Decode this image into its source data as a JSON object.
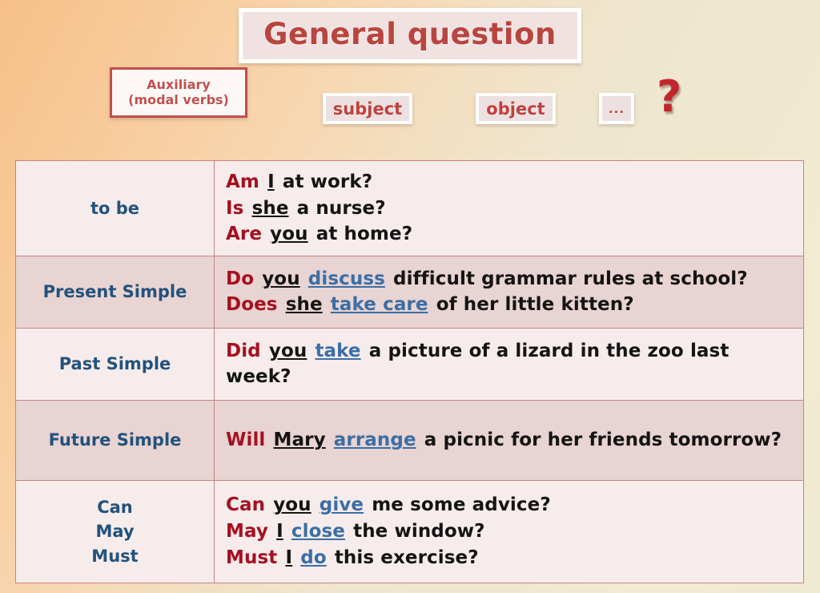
{
  "title": "General question",
  "structure_slots": {
    "auxiliary": "Auxiliary\n(modal verbs)",
    "auxiliary_line1": "Auxiliary",
    "auxiliary_line2": "(modal verbs)",
    "subject": "subject",
    "object": "object",
    "ellipsis": "...",
    "question_mark": "?"
  },
  "table": {
    "rows": [
      {
        "label_lines": [
          "to be"
        ],
        "examples": [
          {
            "aux": "Am",
            "subject": "I",
            "verb": "",
            "rest": "at work?"
          },
          {
            "aux": "Is",
            "subject": "she",
            "verb": "",
            "rest": "a nurse?"
          },
          {
            "aux": "Are",
            "subject": "you",
            "verb": "",
            "rest": "at home?"
          }
        ]
      },
      {
        "label_lines": [
          "Present Simple"
        ],
        "examples": [
          {
            "aux": "Do",
            "subject": "you",
            "verb": "discuss",
            "rest": "difficult grammar rules at school?"
          },
          {
            "aux": "Does",
            "subject": "she",
            "verb": "take care",
            "rest": "of her little kitten?"
          }
        ]
      },
      {
        "label_lines": [
          "Past Simple"
        ],
        "examples": [
          {
            "aux": "Did",
            "subject": "you",
            "verb": "take",
            "rest": "a picture of a lizard in the zoo last week?"
          }
        ]
      },
      {
        "label_lines": [
          "Future Simple"
        ],
        "examples": [
          {
            "aux": "Will",
            "subject": "Mary",
            "verb": "arrange",
            "rest": "a picnic for her friends tomorrow?"
          }
        ]
      },
      {
        "label_lines": [
          "Can",
          "May",
          "Must"
        ],
        "examples": [
          {
            "aux": "Can",
            "subject": "you",
            "verb": "give",
            "rest": "me some advice?"
          },
          {
            "aux": "May",
            "subject": "I",
            "verb": "close",
            "rest": "the window?"
          },
          {
            "aux": "Must",
            "subject": "I",
            "verb": "do",
            "rest": "this exercise?"
          }
        ]
      }
    ]
  },
  "colors": {
    "title_text": "#b8453f",
    "auxiliary_word": "#a51020",
    "subject_word": "#141414",
    "verb_word": "#3b6ea5",
    "row_label": "#23527c",
    "table_border": "#c58383",
    "row_light": "#f6eceb",
    "row_dark": "#e8d4d2",
    "question_mark": "#c0272d"
  }
}
